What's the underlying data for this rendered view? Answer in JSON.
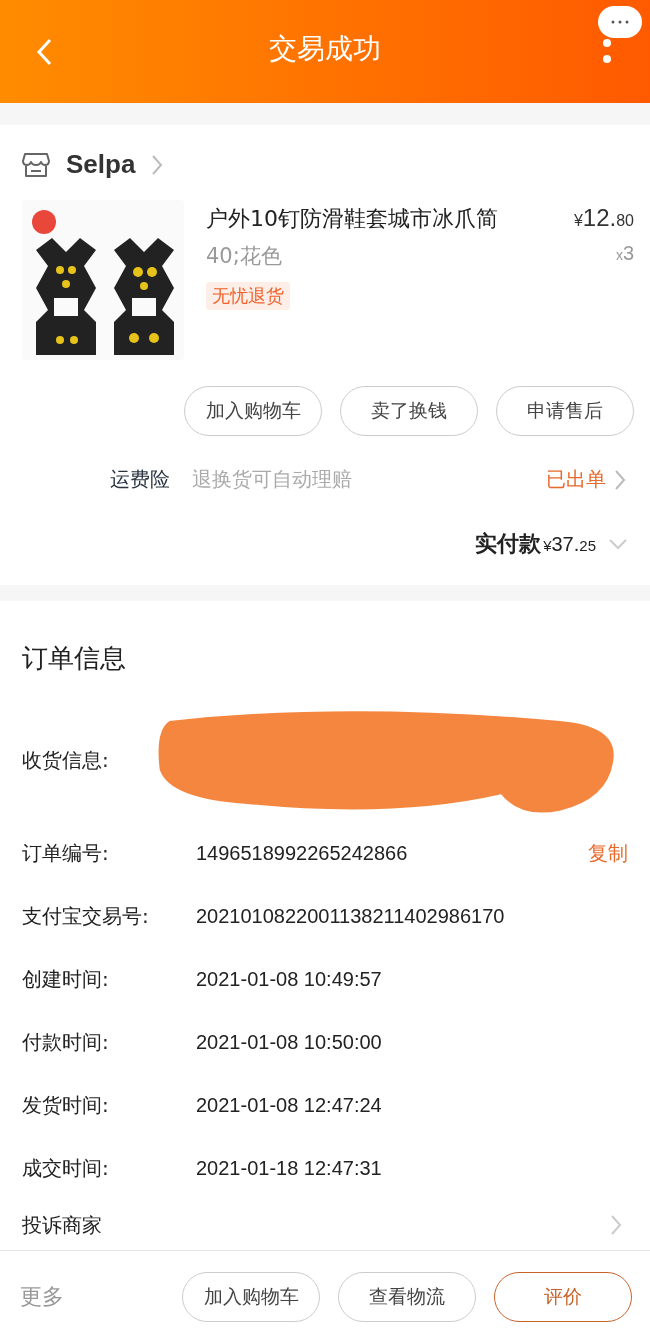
{
  "header": {
    "title": "交易成功"
  },
  "shop": {
    "name": "Selpa"
  },
  "product": {
    "kind": "picture",
    "title": "户外10钉防滑鞋套城市冰爪简",
    "price_symbol": "¥",
    "price_main": "12.",
    "price_cents": "80",
    "quantity_prefix": "x",
    "quantity": "3",
    "sku": "40;花色",
    "tag": "无忧退货"
  },
  "item_actions": [
    {
      "label": "加入购物车",
      "primary": false
    },
    {
      "label": "卖了换钱",
      "primary": false
    },
    {
      "label": "申请售后",
      "primary": false
    }
  ],
  "insurance": {
    "label": "运费险",
    "description": "退换货可自动理赔",
    "status": "已出单"
  },
  "total": {
    "label": "实付款",
    "symbol": "¥",
    "main": "37.",
    "cents": "25"
  },
  "order_info": {
    "title": "订单信息",
    "receiver_label": "收货信息:",
    "rows": [
      {
        "label": "订单编号:",
        "value": "1496518992265242866",
        "action": "复制"
      },
      {
        "label": "支付宝交易号:",
        "value": "2021010822001138211402986170"
      },
      {
        "label": "创建时间:",
        "value": "2021-01-08 10:49:57"
      },
      {
        "label": "付款时间:",
        "value": "2021-01-08 10:50:00"
      },
      {
        "label": "发货时间:",
        "value": "2021-01-08 12:47:24"
      },
      {
        "label": "成交时间:",
        "value": "2021-01-18 12:47:31"
      }
    ],
    "complaint": "投诉商家"
  },
  "bottom_bar": {
    "more": "更多",
    "buttons": [
      {
        "label": "加入购物车",
        "primary": false
      },
      {
        "label": "查看物流",
        "primary": false
      },
      {
        "label": "评价",
        "primary": true
      }
    ]
  }
}
